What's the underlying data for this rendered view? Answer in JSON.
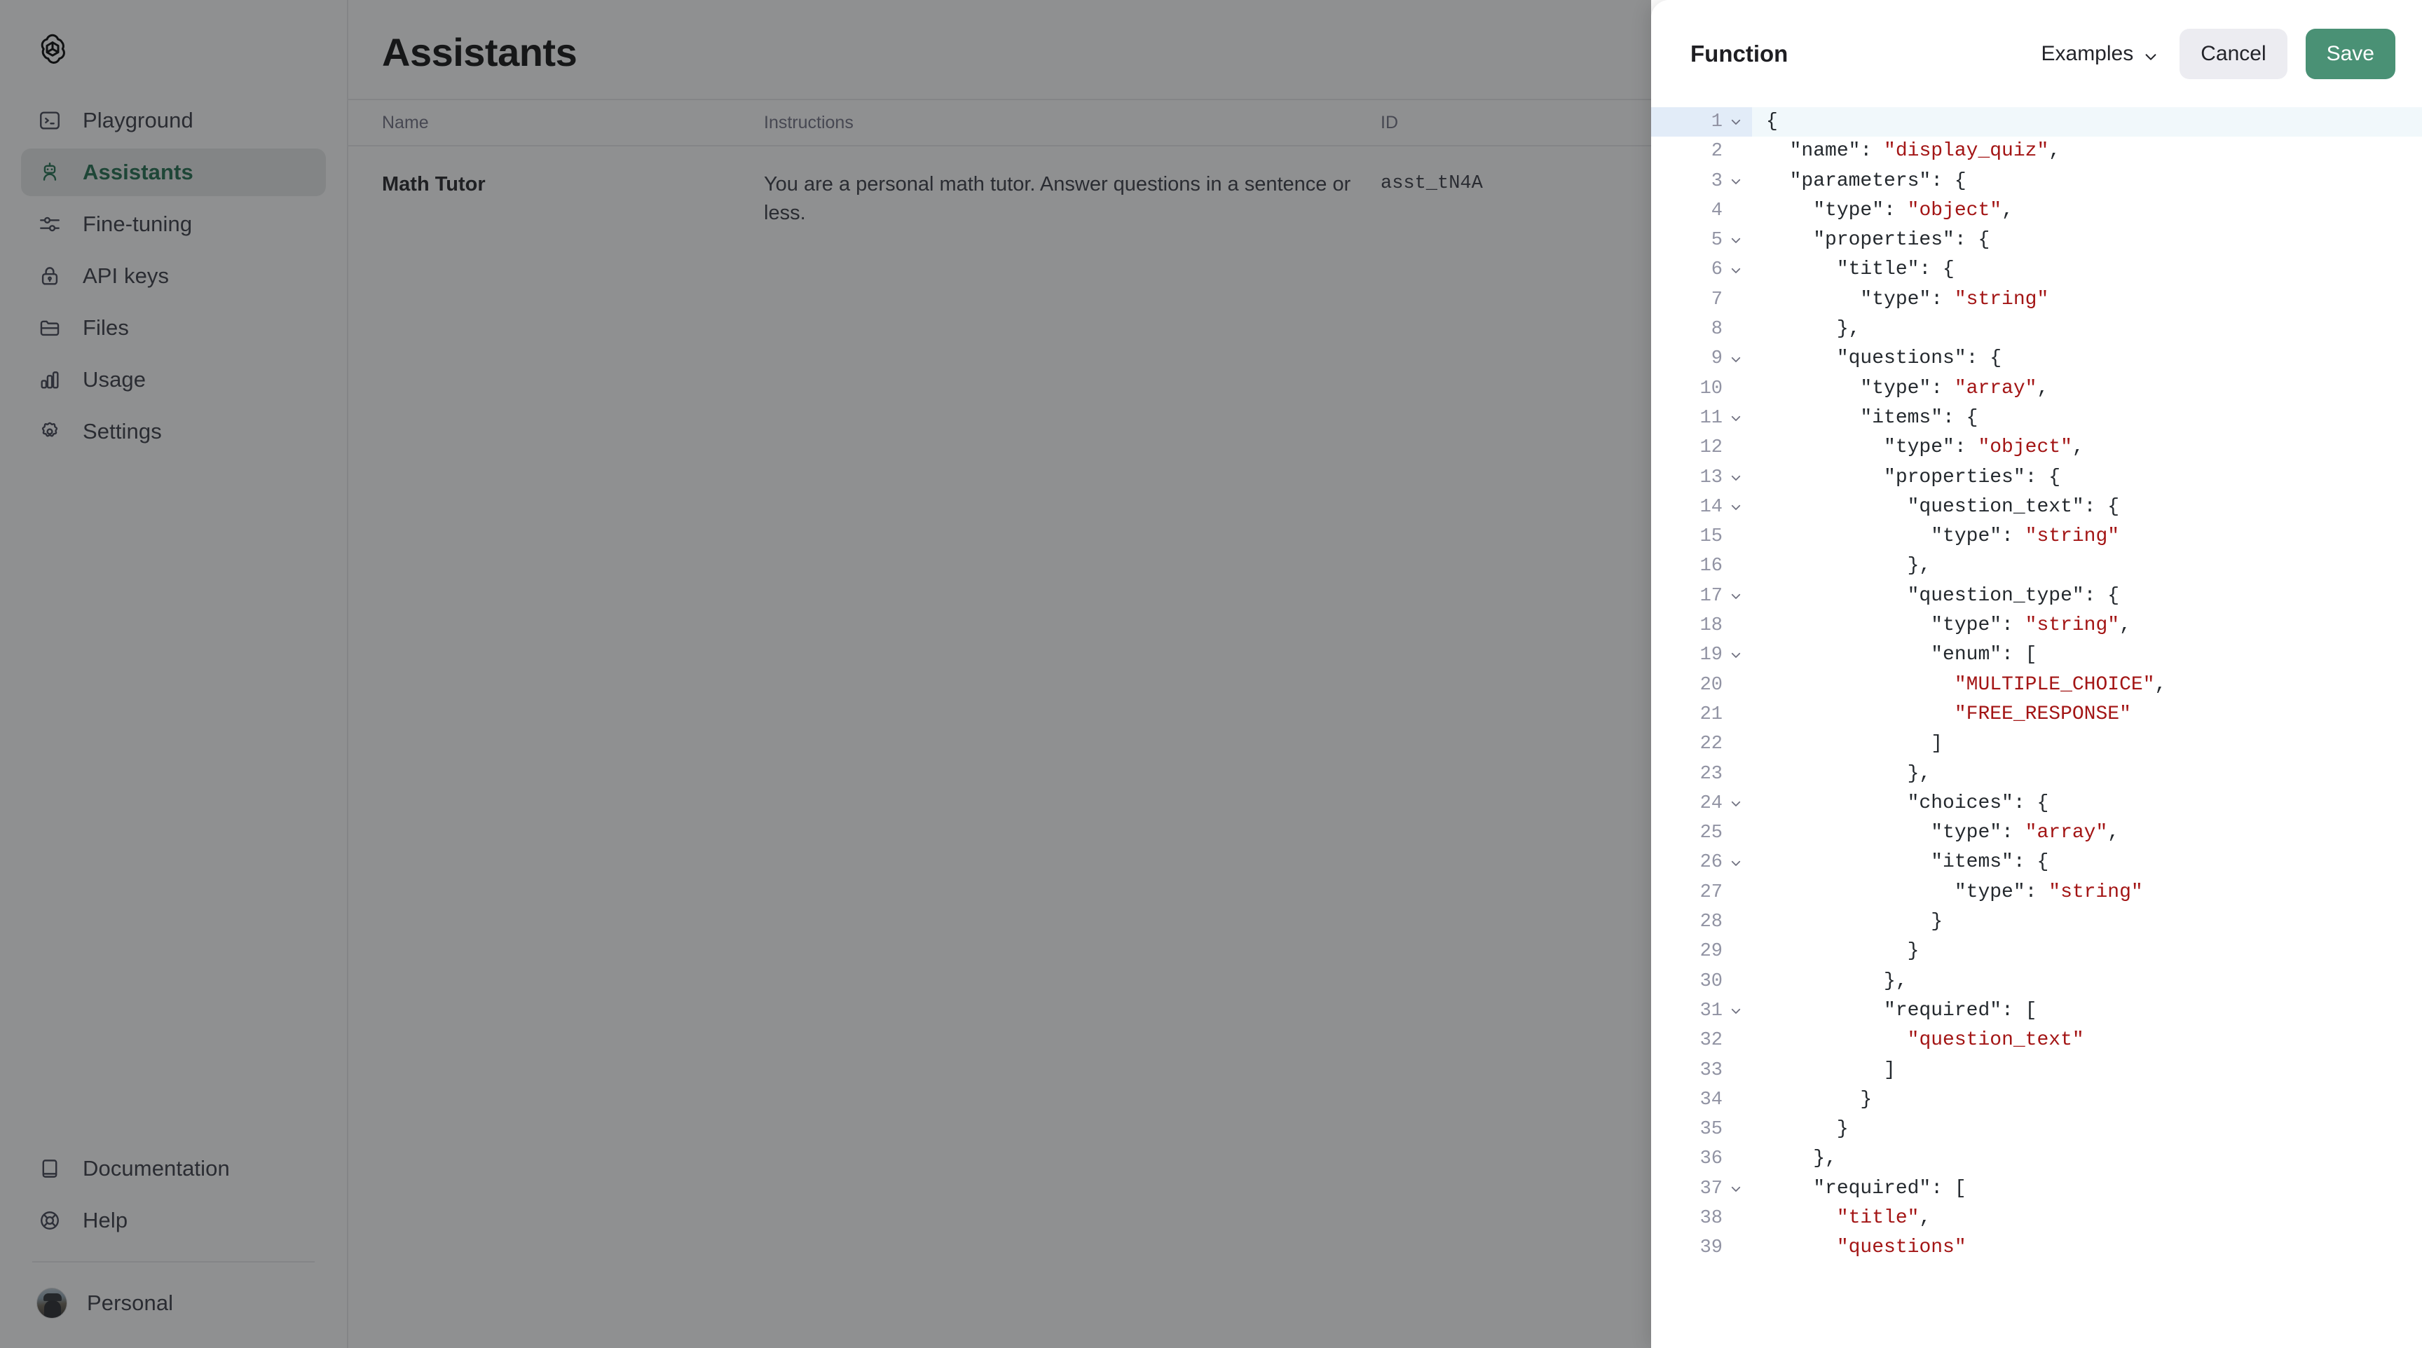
{
  "sidebar": {
    "brand_icon": "openai-logo-icon",
    "items": [
      {
        "label": "Playground",
        "icon": "terminal-icon",
        "active": false
      },
      {
        "label": "Assistants",
        "icon": "robot-icon",
        "active": true
      },
      {
        "label": "Fine-tuning",
        "icon": "sliders-icon",
        "active": false
      },
      {
        "label": "API keys",
        "icon": "lock-icon",
        "active": false
      },
      {
        "label": "Files",
        "icon": "folder-icon",
        "active": false
      },
      {
        "label": "Usage",
        "icon": "bar-chart-icon",
        "active": false
      },
      {
        "label": "Settings",
        "icon": "gear-icon",
        "active": false
      }
    ],
    "bottom_items": [
      {
        "label": "Documentation",
        "icon": "book-icon"
      },
      {
        "label": "Help",
        "icon": "lifebuoy-icon"
      }
    ],
    "account": {
      "label": "Personal",
      "icon": "avatar"
    }
  },
  "main": {
    "title": "Assistants",
    "table": {
      "columns": [
        "Name",
        "Instructions",
        "ID"
      ],
      "rows": [
        {
          "name": "Math Tutor",
          "instructions": "You are a personal math tutor. Answer questions in a sentence or less.",
          "id": "asst_tN4A"
        }
      ]
    }
  },
  "modal": {
    "title": "Function",
    "examples_label": "Examples",
    "examples_chevron": "chevron-down-icon",
    "cancel_label": "Cancel",
    "save_label": "Save",
    "accent_green": "#4a9175",
    "active_line": 1,
    "code_lines": [
      {
        "n": 1,
        "fold": true,
        "tokens": [
          {
            "t": "{",
            "c": "k"
          }
        ]
      },
      {
        "n": 2,
        "fold": false,
        "tokens": [
          {
            "t": "  \"name\": ",
            "c": "k"
          },
          {
            "t": "\"display_quiz\"",
            "c": "s"
          },
          {
            "t": ",",
            "c": "k"
          }
        ]
      },
      {
        "n": 3,
        "fold": true,
        "tokens": [
          {
            "t": "  \"parameters\": {",
            "c": "k"
          }
        ]
      },
      {
        "n": 4,
        "fold": false,
        "tokens": [
          {
            "t": "    \"type\": ",
            "c": "k"
          },
          {
            "t": "\"object\"",
            "c": "s"
          },
          {
            "t": ",",
            "c": "k"
          }
        ]
      },
      {
        "n": 5,
        "fold": true,
        "tokens": [
          {
            "t": "    \"properties\": {",
            "c": "k"
          }
        ]
      },
      {
        "n": 6,
        "fold": true,
        "tokens": [
          {
            "t": "      \"title\": {",
            "c": "k"
          }
        ]
      },
      {
        "n": 7,
        "fold": false,
        "tokens": [
          {
            "t": "        \"type\": ",
            "c": "k"
          },
          {
            "t": "\"string\"",
            "c": "s"
          }
        ]
      },
      {
        "n": 8,
        "fold": false,
        "tokens": [
          {
            "t": "      },",
            "c": "k"
          }
        ]
      },
      {
        "n": 9,
        "fold": true,
        "tokens": [
          {
            "t": "      \"questions\": {",
            "c": "k"
          }
        ]
      },
      {
        "n": 10,
        "fold": false,
        "tokens": [
          {
            "t": "        \"type\": ",
            "c": "k"
          },
          {
            "t": "\"array\"",
            "c": "s"
          },
          {
            "t": ",",
            "c": "k"
          }
        ]
      },
      {
        "n": 11,
        "fold": true,
        "tokens": [
          {
            "t": "        \"items\": {",
            "c": "k"
          }
        ]
      },
      {
        "n": 12,
        "fold": false,
        "tokens": [
          {
            "t": "          \"type\": ",
            "c": "k"
          },
          {
            "t": "\"object\"",
            "c": "s"
          },
          {
            "t": ",",
            "c": "k"
          }
        ]
      },
      {
        "n": 13,
        "fold": true,
        "tokens": [
          {
            "t": "          \"properties\": {",
            "c": "k"
          }
        ]
      },
      {
        "n": 14,
        "fold": true,
        "tokens": [
          {
            "t": "            \"question_text\": {",
            "c": "k"
          }
        ]
      },
      {
        "n": 15,
        "fold": false,
        "tokens": [
          {
            "t": "              \"type\": ",
            "c": "k"
          },
          {
            "t": "\"string\"",
            "c": "s"
          }
        ]
      },
      {
        "n": 16,
        "fold": false,
        "tokens": [
          {
            "t": "            },",
            "c": "k"
          }
        ]
      },
      {
        "n": 17,
        "fold": true,
        "tokens": [
          {
            "t": "            \"question_type\": {",
            "c": "k"
          }
        ]
      },
      {
        "n": 18,
        "fold": false,
        "tokens": [
          {
            "t": "              \"type\": ",
            "c": "k"
          },
          {
            "t": "\"string\"",
            "c": "s"
          },
          {
            "t": ",",
            "c": "k"
          }
        ]
      },
      {
        "n": 19,
        "fold": true,
        "tokens": [
          {
            "t": "              \"enum\": [",
            "c": "k"
          }
        ]
      },
      {
        "n": 20,
        "fold": false,
        "tokens": [
          {
            "t": "                ",
            "c": "k"
          },
          {
            "t": "\"MULTIPLE_CHOICE\"",
            "c": "s"
          },
          {
            "t": ",",
            "c": "k"
          }
        ]
      },
      {
        "n": 21,
        "fold": false,
        "tokens": [
          {
            "t": "                ",
            "c": "k"
          },
          {
            "t": "\"FREE_RESPONSE\"",
            "c": "s"
          }
        ]
      },
      {
        "n": 22,
        "fold": false,
        "tokens": [
          {
            "t": "              ]",
            "c": "k"
          }
        ]
      },
      {
        "n": 23,
        "fold": false,
        "tokens": [
          {
            "t": "            },",
            "c": "k"
          }
        ]
      },
      {
        "n": 24,
        "fold": true,
        "tokens": [
          {
            "t": "            \"choices\": {",
            "c": "k"
          }
        ]
      },
      {
        "n": 25,
        "fold": false,
        "tokens": [
          {
            "t": "              \"type\": ",
            "c": "k"
          },
          {
            "t": "\"array\"",
            "c": "s"
          },
          {
            "t": ",",
            "c": "k"
          }
        ]
      },
      {
        "n": 26,
        "fold": true,
        "tokens": [
          {
            "t": "              \"items\": {",
            "c": "k"
          }
        ]
      },
      {
        "n": 27,
        "fold": false,
        "tokens": [
          {
            "t": "                \"type\": ",
            "c": "k"
          },
          {
            "t": "\"string\"",
            "c": "s"
          }
        ]
      },
      {
        "n": 28,
        "fold": false,
        "tokens": [
          {
            "t": "              }",
            "c": "k"
          }
        ]
      },
      {
        "n": 29,
        "fold": false,
        "tokens": [
          {
            "t": "            }",
            "c": "k"
          }
        ]
      },
      {
        "n": 30,
        "fold": false,
        "tokens": [
          {
            "t": "          },",
            "c": "k"
          }
        ]
      },
      {
        "n": 31,
        "fold": true,
        "tokens": [
          {
            "t": "          \"required\": [",
            "c": "k"
          }
        ]
      },
      {
        "n": 32,
        "fold": false,
        "tokens": [
          {
            "t": "            ",
            "c": "k"
          },
          {
            "t": "\"question_text\"",
            "c": "s"
          }
        ]
      },
      {
        "n": 33,
        "fold": false,
        "tokens": [
          {
            "t": "          ]",
            "c": "k"
          }
        ]
      },
      {
        "n": 34,
        "fold": false,
        "tokens": [
          {
            "t": "        }",
            "c": "k"
          }
        ]
      },
      {
        "n": 35,
        "fold": false,
        "tokens": [
          {
            "t": "      }",
            "c": "k"
          }
        ]
      },
      {
        "n": 36,
        "fold": false,
        "tokens": [
          {
            "t": "    },",
            "c": "k"
          }
        ]
      },
      {
        "n": 37,
        "fold": true,
        "tokens": [
          {
            "t": "    \"required\": [",
            "c": "k"
          }
        ]
      },
      {
        "n": 38,
        "fold": false,
        "tokens": [
          {
            "t": "      ",
            "c": "k"
          },
          {
            "t": "\"title\"",
            "c": "s"
          },
          {
            "t": ",",
            "c": "k"
          }
        ]
      },
      {
        "n": 39,
        "fold": false,
        "tokens": [
          {
            "t": "      ",
            "c": "k"
          },
          {
            "t": "\"questions\"",
            "c": "s"
          }
        ]
      }
    ]
  }
}
